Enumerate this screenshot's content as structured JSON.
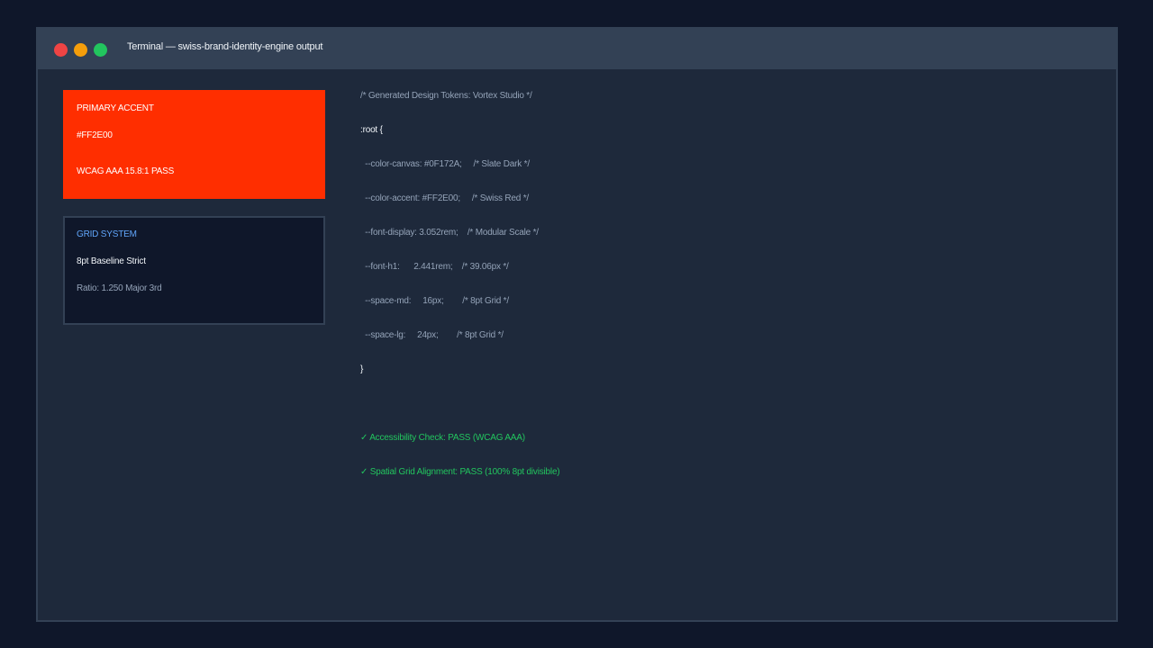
{
  "window": {
    "title": "Terminal — swiss-brand-identity-engine output"
  },
  "colors": {
    "canvas": "#0F172A",
    "panel": "#1E293B",
    "accent": "#FF2E00",
    "success": "#22C55E",
    "info": "#60A5FA"
  },
  "accent_card": {
    "label": "PRIMARY ACCENT",
    "hex": "#FF2E00",
    "wcag": "WCAG AAA 15.8:1 PASS"
  },
  "grid_card": {
    "label": "GRID SYSTEM",
    "value": "8pt Baseline Strict",
    "ratio": "Ratio: 1.250 Major 3rd"
  },
  "code": {
    "comment": "/* Generated Design Tokens: Vortex Studio */",
    "root_open": ":root {",
    "tokens": [
      "  --color-canvas: #0F172A;     /* Slate Dark */",
      "  --color-accent: #FF2E00;     /* Swiss Red */",
      "  --font-display: 3.052rem;    /* Modular Scale */",
      "  --font-h1:      2.441rem;    /* 39.06px */",
      "  --space-md:     16px;        /* 8pt Grid */",
      "  --space-lg:     24px;        /* 8pt Grid */"
    ],
    "root_close": "}",
    "checks": [
      "✓ Accessibility Check: PASS (WCAG AAA)",
      "✓ Spatial Grid Alignment: PASS (100% 8pt divisible)"
    ]
  }
}
